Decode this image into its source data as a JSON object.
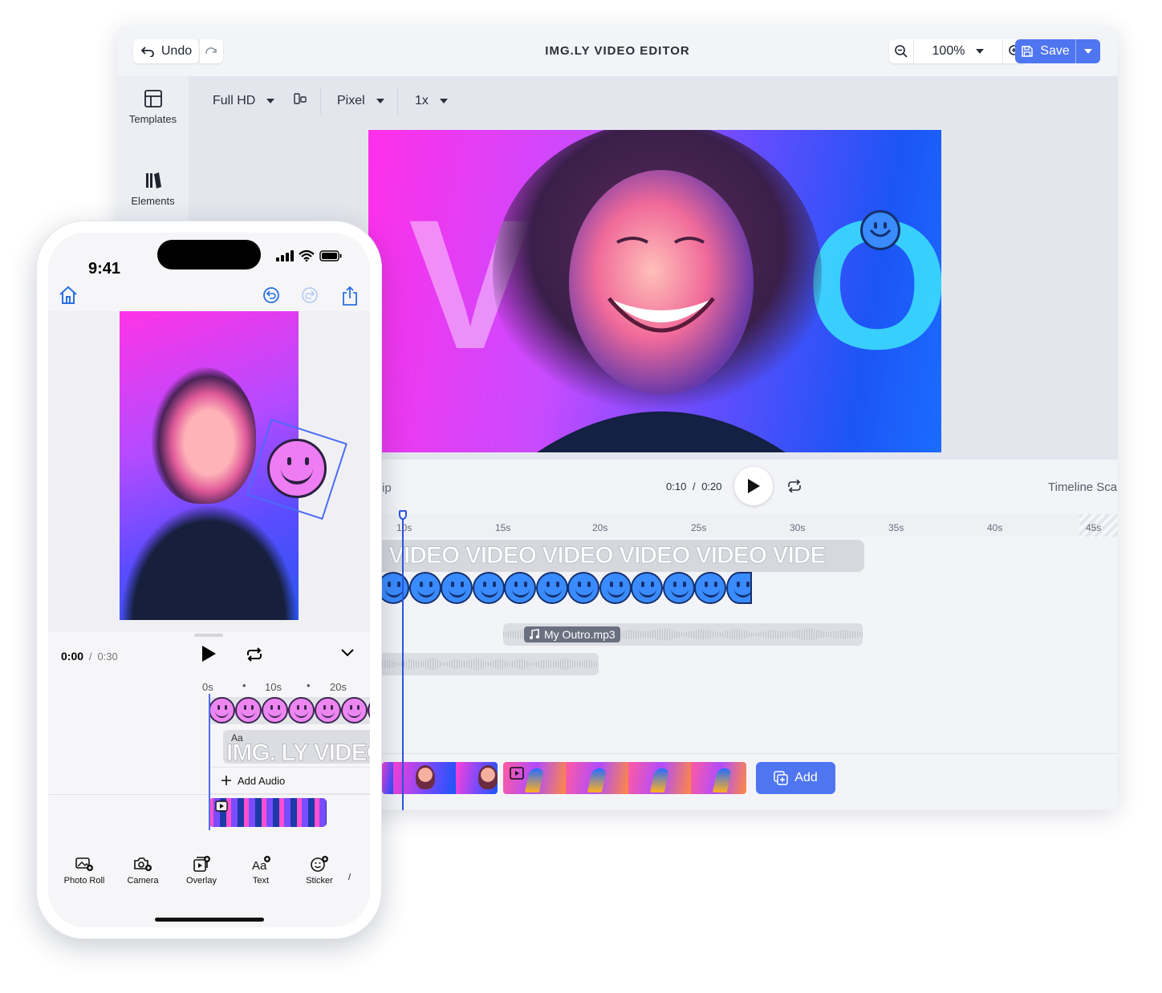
{
  "desktop": {
    "title": "IMG.LY VIDEO EDITOR",
    "undo_label": "Undo",
    "zoom_value": "100%",
    "save_label": "Save",
    "sidebar": [
      {
        "label": "Templates",
        "icon": "templates-icon"
      },
      {
        "label": "Elements",
        "icon": "elements-icon"
      }
    ],
    "toolbar": {
      "resolution": "Full HD",
      "unit": "Pixel",
      "scale": "1x"
    },
    "canvas_text": {
      "v": "V",
      "o": "O"
    },
    "playback": {
      "clip_label": "ip",
      "current_time": "0:10",
      "separator": "/",
      "total_time": "0:20",
      "timeline_scale_label": "Timeline Sca"
    },
    "ruler_ticks": [
      "10s",
      "15s",
      "20s",
      "25s",
      "30s",
      "35s",
      "40s",
      "45s"
    ],
    "text_track": "VIDEO  VIDEO  VIDEO  VIDEO  VIDEO  VIDE",
    "audio_track_label": "My Outro.mp3",
    "add_label": "Add",
    "colors": {
      "accent": "#4f76f0",
      "playhead": "#2a55e0"
    }
  },
  "phone": {
    "status_time": "9:41",
    "current_time": "0:00",
    "separator": "/",
    "duration": "0:30",
    "ruler": [
      "0s",
      "10s",
      "20s"
    ],
    "text_track_icon": "Aa",
    "text_track": "IMG. LY VIDEO",
    "add_audio_label": "Add Audio",
    "tools": [
      "Photo Roll",
      "Camera",
      "Overlay",
      "Text",
      "Sticker"
    ]
  }
}
